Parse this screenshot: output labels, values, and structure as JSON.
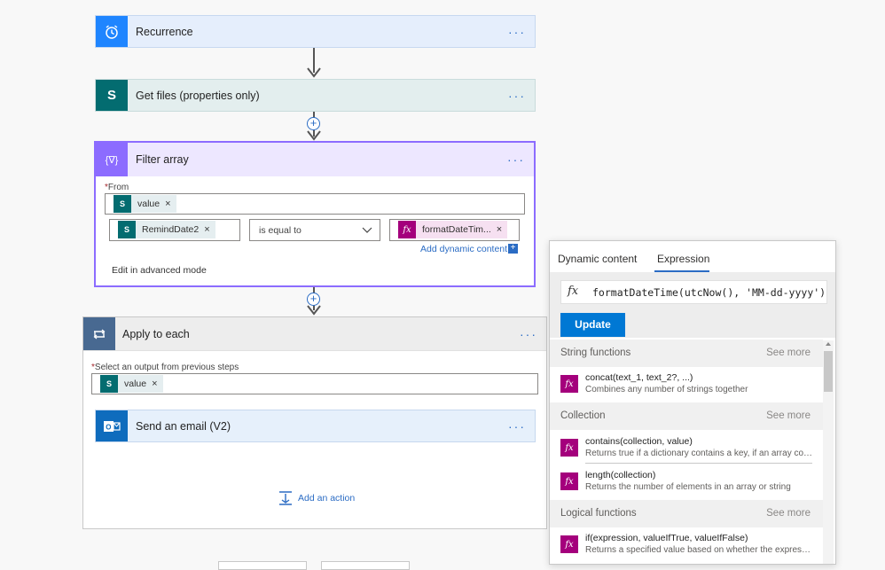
{
  "flow": {
    "recurrence": {
      "title": "Recurrence",
      "more": "···"
    },
    "get_files": {
      "title": "Get files (properties only)",
      "icon_text": "S",
      "more": "···"
    },
    "filter_array": {
      "title": "Filter array",
      "icon_text": "{∇}",
      "more": "···",
      "from_required": "*",
      "from_label": "From",
      "from_token": "value",
      "left_token": "RemindDate2",
      "operator": "is equal to",
      "right_token": "formatDateTim...",
      "add_dynamic": "Add dynamic content",
      "advanced": "Edit in advanced mode"
    },
    "apply_each": {
      "title": "Apply to each",
      "more": "···",
      "select_required": "*",
      "select_label": "Select an output from previous steps",
      "token": "value",
      "send_email": {
        "title": "Send an email (V2)",
        "more": "···"
      },
      "add_action": "Add an action"
    }
  },
  "panel": {
    "tabs": [
      {
        "label": "Dynamic content",
        "active": false
      },
      {
        "label": "Expression",
        "active": true
      }
    ],
    "fx_symbol": "fx",
    "expression": "formatDateTime(utcNow(), 'MM-dd-yyyy')",
    "update_label": "Update",
    "sections": [
      {
        "title": "String functions",
        "see_more": "See more",
        "items": [
          {
            "name": "concat(text_1, text_2?, ...)",
            "desc": "Combines any number of strings together"
          }
        ]
      },
      {
        "title": "Collection",
        "see_more": "See more",
        "items": [
          {
            "name": "contains(collection, value)",
            "desc": "Returns true if a dictionary contains a key, if an array con..."
          },
          {
            "name": "length(collection)",
            "desc": "Returns the number of elements in an array or string"
          }
        ]
      },
      {
        "title": "Logical functions",
        "see_more": "See more",
        "items": [
          {
            "name": "if(expression, valueIfTrue, valueIfFalse)",
            "desc": "Returns a specified value based on whether the expressio..."
          }
        ]
      }
    ]
  },
  "colors": {
    "recurrence": "#1f85ff",
    "sharepoint": "#036c70",
    "filter": "#8c6cff",
    "apply_each": "#486991",
    "outlook": "#0f6cbd",
    "fx": "#a4007c",
    "accent": "#2b6cc4"
  }
}
